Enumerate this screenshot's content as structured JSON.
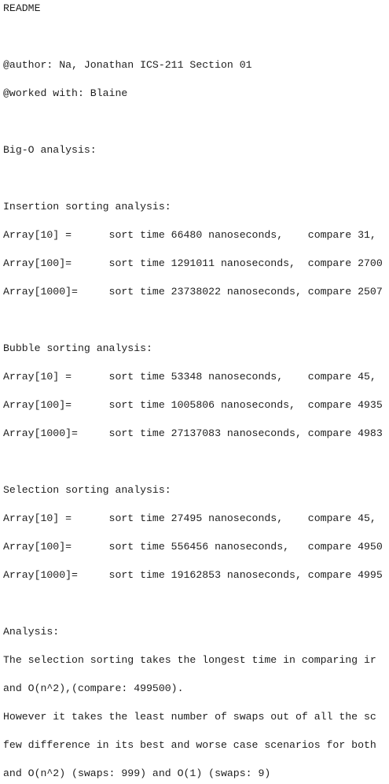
{
  "document": {
    "lines": [
      "README",
      "",
      "@author: Na, Jonathan ICS-211 Section 01",
      "@worked with: Blaine",
      "",
      "Big-O analysis:",
      "",
      "Insertion sorting analysis:",
      "Array[10] =      sort time 66480 nanoseconds,    compare 31,",
      "Array[100]=      sort time 1291011 nanoseconds,  compare 2700",
      "Array[1000]=     sort time 23738022 nanoseconds, compare 2507",
      "",
      "Bubble sorting analysis:",
      "Array[10] =      sort time 53348 nanoseconds,    compare 45,",
      "Array[100]=      sort time 1005806 nanoseconds,  compare 4935",
      "Array[1000]=     sort time 27137083 nanoseconds, compare 4983",
      "",
      "Selection sorting analysis:",
      "Array[10] =      sort time 27495 nanoseconds,    compare 45,",
      "Array[100]=      sort time 556456 nanoseconds,   compare 4950",
      "Array[1000]=     sort time 19162853 nanoseconds, compare 4995",
      "",
      "Analysis:",
      "The selection sorting takes the longest time in comparing ir",
      "and O(n^2),(compare: 499500).",
      "However it takes the least number of swaps out of all the sc",
      "few difference in its best and worse case scenarios for both",
      "and O(n^2) (swaps: 999) and O(1) (swaps: 9)"
    ]
  }
}
